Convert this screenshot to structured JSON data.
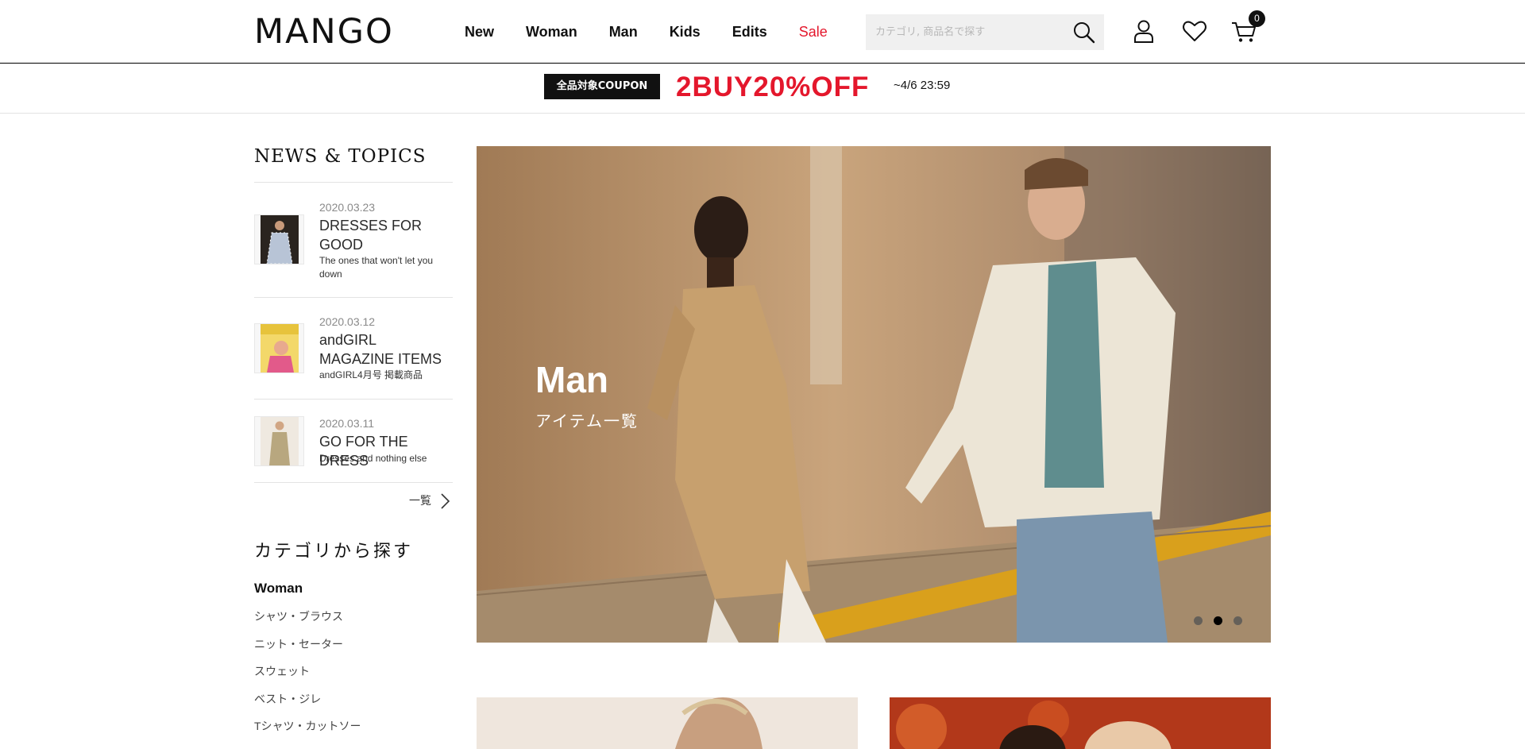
{
  "header": {
    "logo": "MANGO",
    "nav": [
      "New",
      "Woman",
      "Man",
      "Kids",
      "Edits",
      "Sale"
    ],
    "search_placeholder": "カテゴリ, 商品名で探す",
    "cart_count": "0"
  },
  "promo": {
    "tag": "全品対象COUPON",
    "headline": "2BUY20%OFF",
    "period": "~4/6 23:59"
  },
  "news": {
    "title": "NEWS & TOPICS",
    "items": [
      {
        "date": "2020.03.23",
        "title": "DRESSES FOR GOOD",
        "subtitle": "The ones that won't let you down"
      },
      {
        "date": "2020.03.12",
        "title": "andGIRL MAGAZINE ITEMS",
        "subtitle": "andGIRL4月号 掲載商品"
      },
      {
        "date": "2020.03.11",
        "title": "GO FOR THE DRESS",
        "subtitle": "Dresses and nothing else"
      }
    ],
    "more_label": "一覧"
  },
  "categories": {
    "title": "カテゴリから探す",
    "group": "Woman",
    "items": [
      "シャツ・ブラウス",
      "ニット・セーター",
      "スウェット",
      "ベスト・ジレ",
      "Tシャツ・カットソー"
    ]
  },
  "hero": {
    "title": "Man",
    "subtitle": "アイテム一覧",
    "slide_count": 3,
    "active_slide": 2
  },
  "icons": {
    "search": "search-icon",
    "account": "user-icon",
    "wishlist": "heart-icon",
    "cart": "cart-icon",
    "more": "chevron-right-icon"
  },
  "colors": {
    "sale": "#e4172c",
    "promo_headline": "#e4172c",
    "coupon_tag_bg": "#111111"
  }
}
